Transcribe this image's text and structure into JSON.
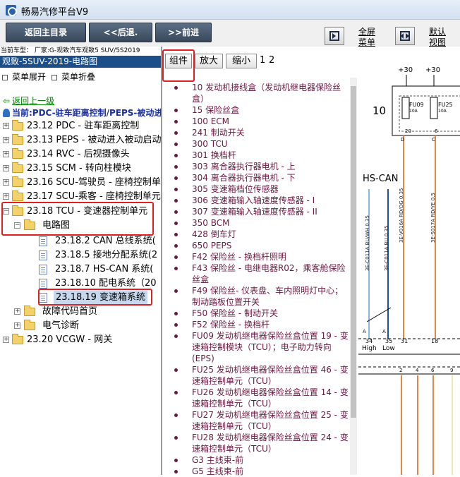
{
  "window": {
    "title": "畅易汽修平台V9"
  },
  "toolbar": {
    "home": "返回主目录",
    "back": "<<后退.",
    "forward": ">>前进",
    "fullscreen": [
      "全屏",
      "菜单"
    ],
    "default": [
      "默认",
      "视图"
    ]
  },
  "model_info": "当前车型： 厂家:G-观致汽车观致5 SUV/5S2019",
  "left": {
    "header": "观致-5SUV-2019-电路图",
    "expand_all": "菜单展开",
    "collapse_all": "菜单折叠",
    "back_up": "返回上一级",
    "current": "当前:PDC-驻车距离控制/PEPS-被动进入",
    "tree": [
      {
        "label": "23.12 PDC - 驻车距离控制"
      },
      {
        "label": "23.13 PEPS - 被动进入被动启动"
      },
      {
        "label": "23.14 RVC - 后视摄像头"
      },
      {
        "label": "23.15 SCM - 转向柱模块"
      },
      {
        "label": "23.16 SCU-驾驶员 - 座椅控制单元"
      },
      {
        "label": "23.17 SCU-乘客 - 座椅控制单元"
      },
      {
        "label": "23.18 TCU - 变速器控制单元"
      },
      {
        "label": "电路图"
      },
      {
        "label": "23.18.2 CAN 总线系统("
      },
      {
        "label": "23.18.5 接地分配系统(2"
      },
      {
        "label": "23.18.7 HS-CAN 系统("
      },
      {
        "label": "23.18.10 配电系统（20"
      },
      {
        "label": "23.18.19 变速箱系统"
      },
      {
        "label": "故障代码首页"
      },
      {
        "label": "电气诊断"
      },
      {
        "label": "23.20 VCGW - 网关"
      }
    ]
  },
  "middle": {
    "tabs": [
      "组件",
      "放大",
      "缩小"
    ],
    "pages": [
      "1",
      "2"
    ],
    "components": [
      "10 发动机接线盒（发动机继电器保险丝盒）",
      "15 保险丝盒",
      "100 ECM",
      "241 制动开关",
      "300 TCU",
      "301 换档杆",
      "303 离合器执行器电机 - 上",
      "304 离合器执行器电机 - 下",
      "305 变速箱档位传感器",
      "306 变速箱输入轴速度传感器 - I",
      "307 变速箱输入轴速度传感器 - II",
      "350 BCM",
      "428 倒车灯",
      "650 PEPS",
      "F42 保险丝 - 换档杆照明",
      "F43 保险丝 - 电继电器R02，乘客舱保险丝盒",
      "F49 保险丝- 仪表盘、车内照明灯中心；制动踏板位置开关",
      "F50 保险丝 - 制动开关",
      "F52 保险丝 - 换档杆",
      "FU09 发动机继电器保险丝盒位置 19 - 变速箱控制模块（TCU）；电子助力转向(EPS)",
      "FU25 发动机继电器保险丝盒位置 46 - 变速箱控制单元（TCU）",
      "FU26 发动机继电器保险丝盒位置 14 - 变速箱控制单元（TCU）",
      "FU27 发动机继电器保险丝盒位置 25 - 变速箱控制单元（TCU）",
      "FU28 发动机继电器保险丝盒位置 24 - 变速箱控制单元（TCU）",
      "G3 主线束-前",
      "G5 主线束-前"
    ]
  },
  "diagram": {
    "supply": [
      "+30",
      "+30"
    ],
    "box_number": "10",
    "fuses": [
      {
        "name": "FU09",
        "rating": "10A"
      },
      {
        "name": "FU25",
        "rating": "10A"
      }
    ],
    "box_pins": [
      "20",
      "6"
    ],
    "box_pin_letters": [
      "D",
      "C"
    ],
    "bus_label": "HS-CAN",
    "wires": [
      "3E-C011A BU/WH 0.35",
      "3E-C011A BU 0.35",
      "3E-V016A RD/OG 0.35",
      "3E-S017A RD/YE 0.5"
    ],
    "pin_letters": [
      "A",
      "A"
    ],
    "tcu_pins": [
      "34",
      "35",
      "31",
      "18"
    ],
    "can_labels": [
      "High",
      "Low"
    ],
    "bottom_pins": [
      "2",
      "4",
      "6",
      "9"
    ],
    "colors": {
      "orange_wire": "#e0874a",
      "blue_wire": "#1f4fa0",
      "light_blue_wire": "#8fb3d9",
      "cream_wire": "#f2e6b0"
    }
  }
}
